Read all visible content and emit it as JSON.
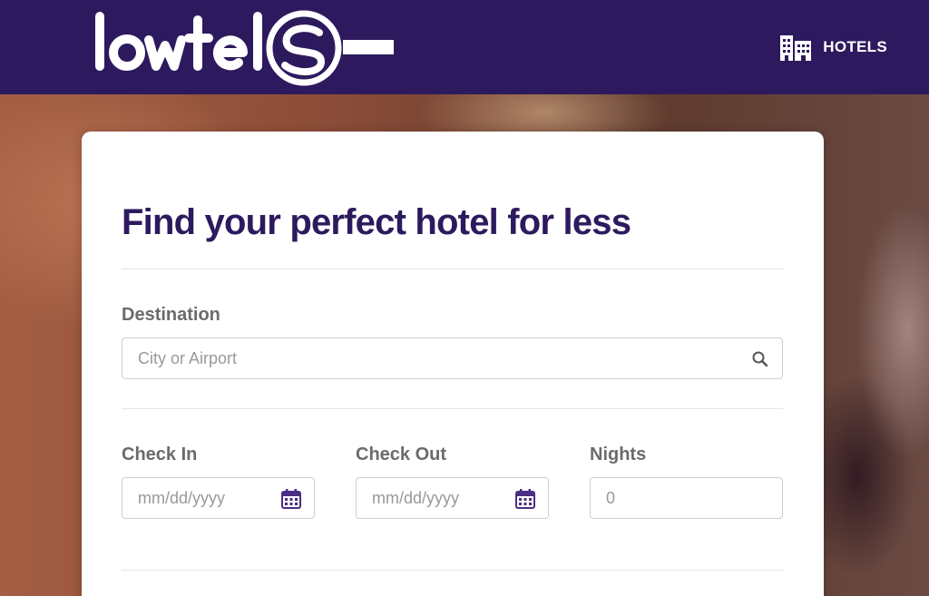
{
  "header": {
    "logo_text": "lowtelS",
    "nav_hotels_label": "HOTELS",
    "nav_hotels_icon": "building-icon",
    "background": "#2d1a5e"
  },
  "search_card": {
    "title": "Find your perfect hotel for less",
    "destination": {
      "label": "Destination",
      "placeholder": "City or Airport",
      "value": "",
      "icon": "search-icon"
    },
    "check_in": {
      "label": "Check In",
      "placeholder": "mm/dd/yyyy",
      "value": "",
      "icon": "calendar-icon"
    },
    "check_out": {
      "label": "Check Out",
      "placeholder": "mm/dd/yyyy",
      "value": "",
      "icon": "calendar-icon"
    },
    "nights": {
      "label": "Nights",
      "placeholder": "0",
      "value": ""
    }
  },
  "colors": {
    "brand_purple": "#2d1a5e",
    "calendar_icon": "#4b2d83"
  }
}
